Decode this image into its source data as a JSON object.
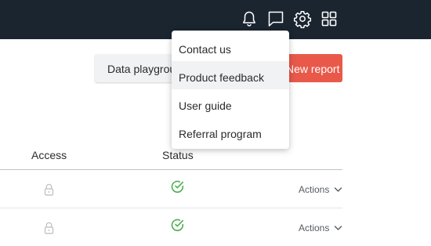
{
  "topbar": {
    "icons": [
      "bell-icon",
      "chat-icon",
      "gear-icon",
      "grid-icon"
    ]
  },
  "toolbar": {
    "playground_label": "Data playground",
    "new_report_label": "New report"
  },
  "table": {
    "headers": {
      "access": "Access",
      "status": "Status"
    },
    "rows": [
      {
        "access_icon": "lock-icon",
        "status_icon": "check-circle-icon",
        "actions_label": "Actions"
      },
      {
        "access_icon": "lock-icon",
        "status_icon": "check-circle-icon",
        "actions_label": "Actions"
      }
    ]
  },
  "help_menu": {
    "items": [
      {
        "label": "Contact us"
      },
      {
        "label": "Product feedback",
        "highlighted": true
      },
      {
        "label": "User guide"
      },
      {
        "label": "Referral program"
      }
    ]
  },
  "colors": {
    "topbar": "#1a2530",
    "primary_button": "#e9594a",
    "status_ok": "#4caf50"
  }
}
